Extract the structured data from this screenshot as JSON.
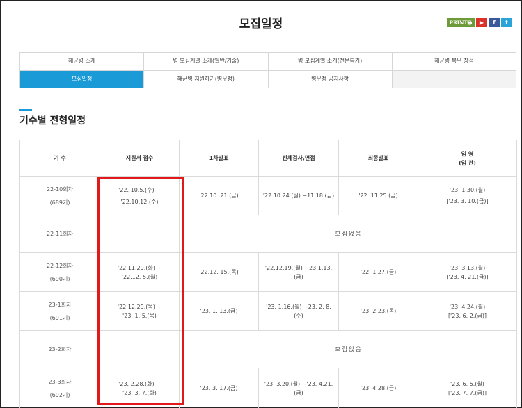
{
  "page": {
    "title": "모집일정"
  },
  "share": {
    "print_label": "PRINT🖶",
    "youtube_label": "▶",
    "facebook_label": "f",
    "twitter_label": "t"
  },
  "tabs": {
    "row1": [
      "해군병 소개",
      "병 모집계열 소개(일반/기술)",
      "병 모집계열 소개(전문특기)",
      "해군병 복무 장점"
    ],
    "row2": [
      "모집일정",
      "해군병 지원하기(병무청)",
      "병무청 공지사항",
      ""
    ]
  },
  "section": {
    "title": "기수별 전형일정"
  },
  "table": {
    "headers": [
      "기 수",
      "지원서 접수",
      "1차발표",
      "신체검사,면접",
      "최종발표",
      "임 영",
      "(임 관)"
    ],
    "rows": [
      {
        "ki": "22-10회차",
        "gen": "(689기)",
        "apply1": "'22. 10.5.(수) ~",
        "apply2": "'22.10.12.(수)",
        "first": "'22.10. 21.(금)",
        "exam1": "'22.10.24.(월) ~11.18.(금)",
        "exam2": "",
        "final": "'22. 11.25.(금)",
        "enlist1": "'23. 1.30.(월)",
        "enlist2": "['23. 3. 10.(금)]"
      },
      {
        "ki": "22-11회차",
        "none": "모 집 없 음"
      },
      {
        "ki": "22-12회차",
        "gen": "(690기)",
        "apply1": "'22.11.29.(화) ~",
        "apply2": "'22.12. 5.(월)",
        "first": "'22.12. 15.(목)",
        "exam1": "'22.12.19.(월) ~23.1.13.",
        "exam2": "(금)",
        "final": "'22. 1.27.(금)",
        "enlist1": "'23. 3.13.(월)",
        "enlist2": "['23. 4. 21.(금)]"
      },
      {
        "ki": "23-1회차",
        "gen": "(691기)",
        "apply1": "'22.12.29.(목) ~",
        "apply2": "'23. 1. 5.(목)",
        "first": "'23. 1. 13.(금)",
        "exam1": "'23. 1.16.(월) ~23. 2. 8.",
        "exam2": "(수)",
        "final": "'23. 2.23.(목)",
        "enlist1": "'23. 4.24.(월)",
        "enlist2": "['23. 6. 2.(금)]"
      },
      {
        "ki": "23-2회차",
        "none": "모 집 없 음"
      },
      {
        "ki": "23-3회차",
        "gen": "(692기)",
        "apply1": "'23. 2.28.(화) ~",
        "apply2": "'23. 3. 7.(화)",
        "first": "'23. 3. 17.(금)",
        "exam1": "'23. 3.20.(월) ~'23. 4.21.",
        "exam2": "(금)",
        "final": "'23. 4.28.(금)",
        "enlist1": "'23. 6. 5.(월)",
        "enlist2": "['23. 7. 7.(금)]"
      }
    ]
  },
  "colors": {
    "accent": "#1a9ad6",
    "highlight": "#e01a1a"
  }
}
